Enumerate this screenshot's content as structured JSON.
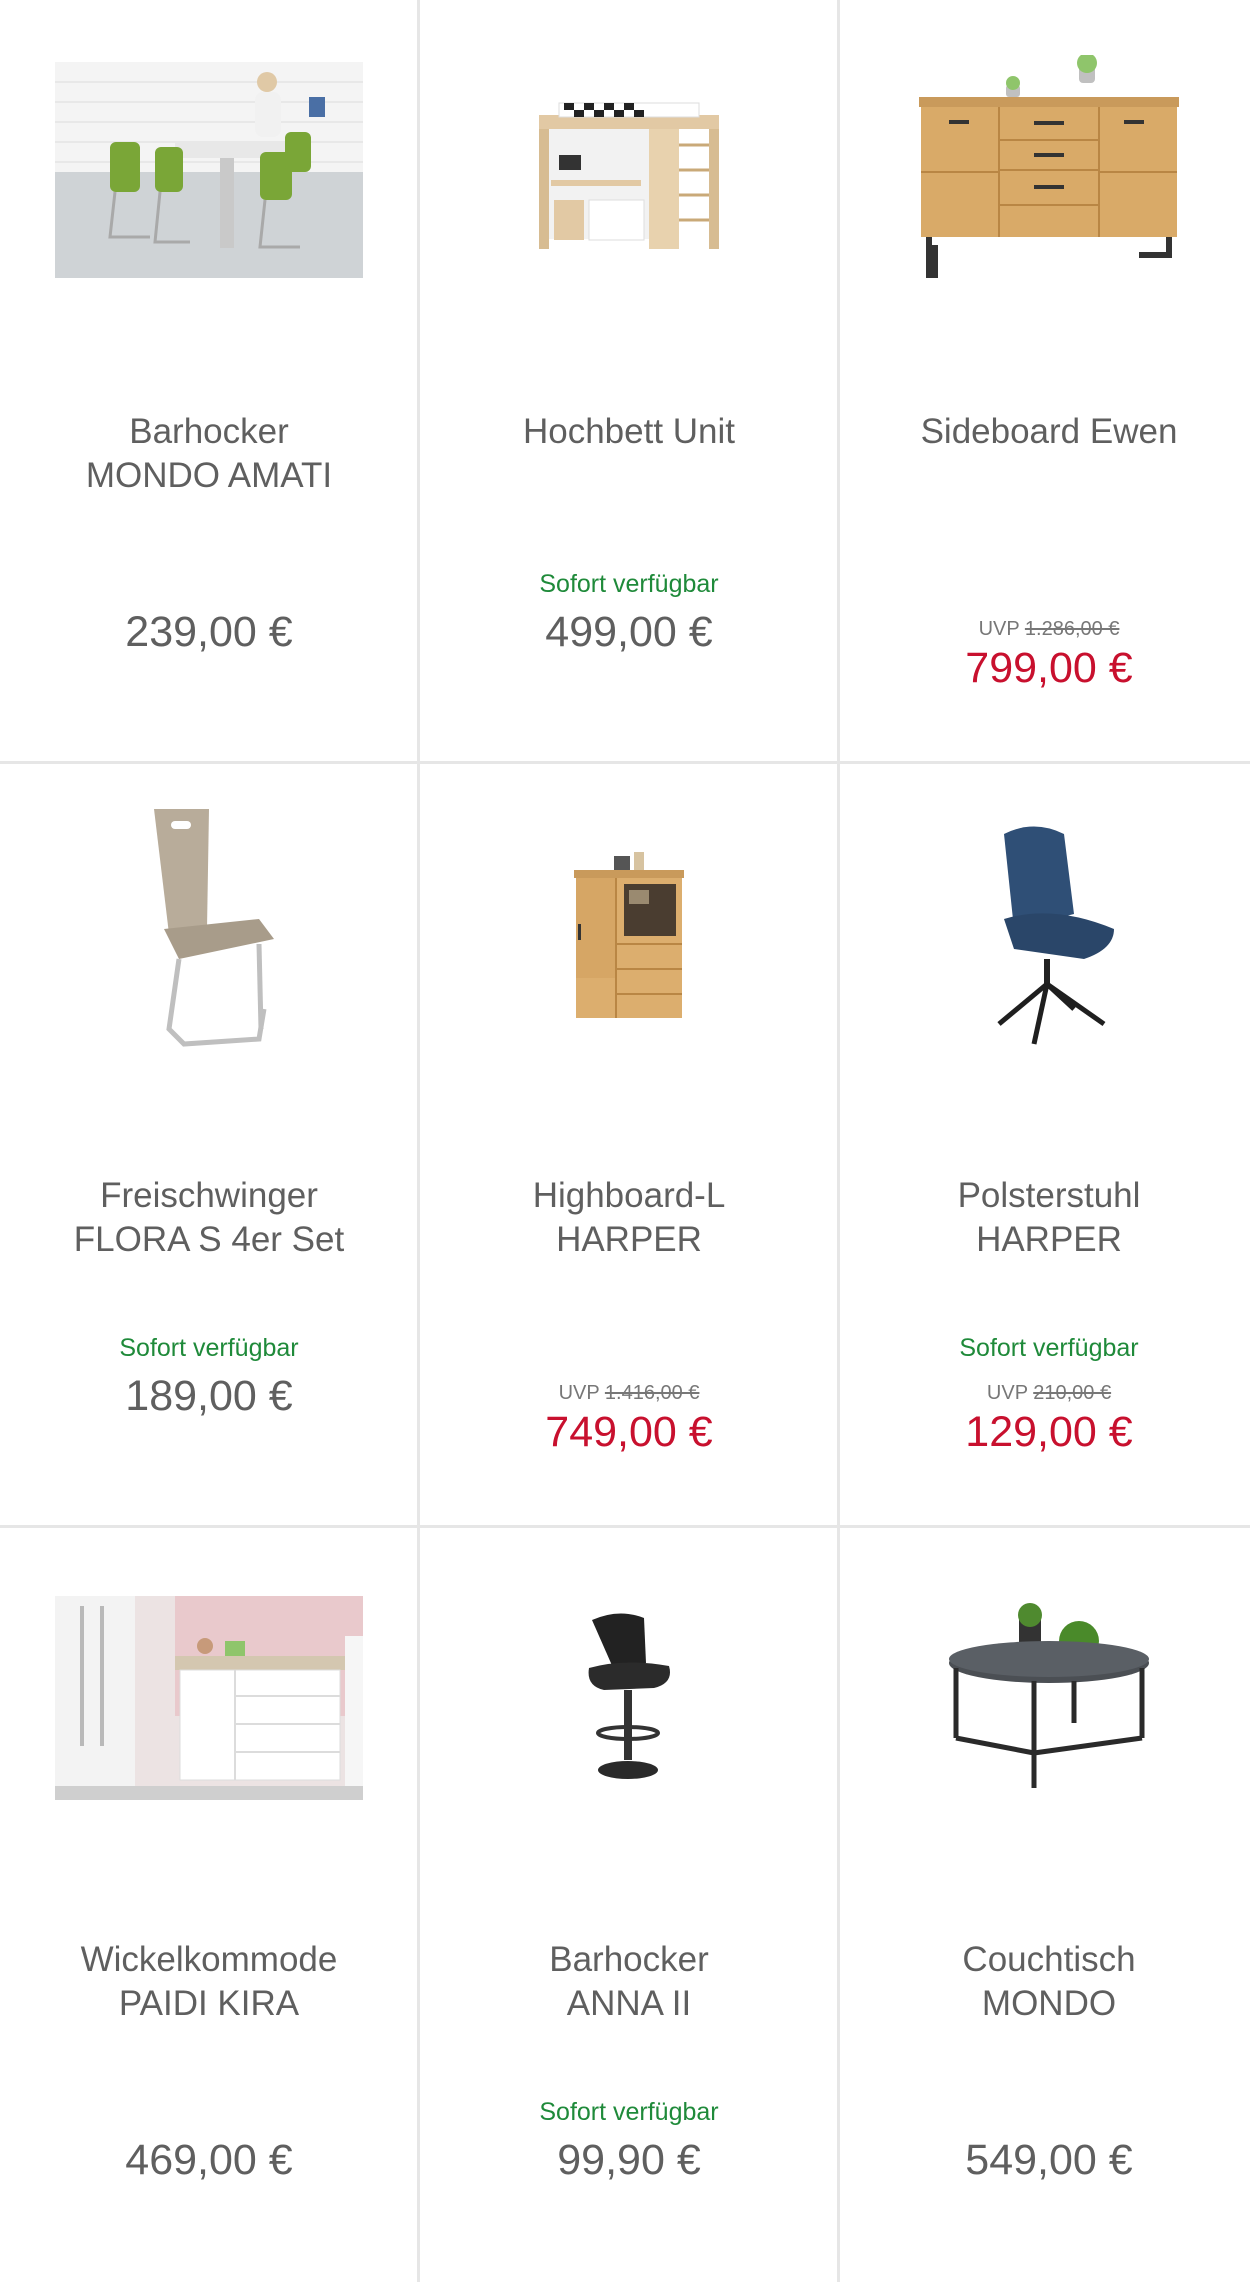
{
  "products": [
    {
      "name_line1": "Barhocker",
      "name_line2": "MONDO AMATI",
      "availability": "",
      "uvp_label": "",
      "uvp_price": "",
      "price": "239,00 €",
      "sale": false,
      "image_icon": "barstool-photo-icon"
    },
    {
      "name_line1": "Hochbett Unit",
      "name_line2": "",
      "availability": "Sofort verfügbar",
      "uvp_label": "",
      "uvp_price": "",
      "price": "499,00 €",
      "sale": false,
      "image_icon": "loft-bed-icon"
    },
    {
      "name_line1": "Sideboard Ewen",
      "name_line2": "",
      "availability": "",
      "uvp_label": "UVP",
      "uvp_price": "1.286,00 €",
      "price": "799,00 €",
      "sale": true,
      "image_icon": "sideboard-icon"
    },
    {
      "name_line1": "Freischwinger",
      "name_line2": "FLORA S 4er Set",
      "availability": "Sofort verfügbar",
      "uvp_label": "",
      "uvp_price": "",
      "price": "189,00 €",
      "sale": false,
      "image_icon": "cantilever-chair-icon"
    },
    {
      "name_line1": "Highboard-L",
      "name_line2": "HARPER",
      "availability": "",
      "uvp_label": "UVP",
      "uvp_price": "1.416,00 €",
      "price": "749,00 €",
      "sale": true,
      "image_icon": "highboard-icon"
    },
    {
      "name_line1": "Polsterstuhl",
      "name_line2": "HARPER",
      "availability": "Sofort verfügbar",
      "uvp_label": "UVP",
      "uvp_price": "210,00 €",
      "price": "129,00 €",
      "sale": true,
      "image_icon": "upholstered-chair-icon"
    },
    {
      "name_line1": "Wickelkommode",
      "name_line2": "PAIDI KIRA",
      "availability": "",
      "uvp_label": "",
      "uvp_price": "",
      "price": "469,00 €",
      "sale": false,
      "image_icon": "changing-dresser-photo-icon"
    },
    {
      "name_line1": "Barhocker",
      "name_line2": "ANNA II",
      "availability": "Sofort verfügbar",
      "uvp_label": "",
      "uvp_price": "",
      "price": "99,90 €",
      "sale": false,
      "image_icon": "bar-stool-icon"
    },
    {
      "name_line1": "Couchtisch",
      "name_line2": "MONDO",
      "availability": "",
      "uvp_label": "",
      "uvp_price": "",
      "price": "549,00 €",
      "sale": false,
      "image_icon": "coffee-table-icon"
    }
  ],
  "colors": {
    "text": "#5f5f5f",
    "available": "#1f8a3a",
    "sale_price": "#c8102e",
    "divider": "#e6e6e6"
  }
}
